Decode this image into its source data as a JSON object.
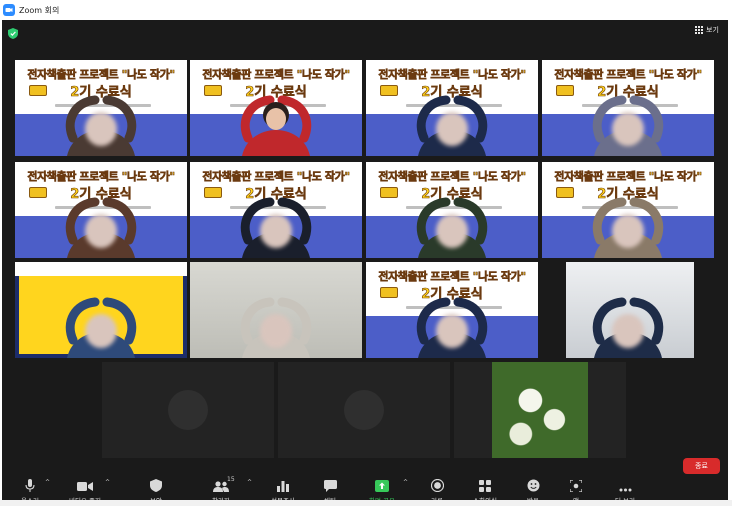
{
  "window": {
    "title": "Zoom 회의"
  },
  "header": {
    "view_label": "보기"
  },
  "slide": {
    "line1": "전자책출판 프로젝트 \"나도 작가\"",
    "line2": "2기 수료식"
  },
  "gallery": {
    "rows": [
      [
        {
          "kind": "slide",
          "active": false
        },
        {
          "kind": "slide",
          "active": true
        },
        {
          "kind": "slide",
          "active": false
        },
        {
          "kind": "slide",
          "active": false
        }
      ],
      [
        {
          "kind": "slide",
          "active": false
        },
        {
          "kind": "slide",
          "active": false
        },
        {
          "kind": "slide",
          "active": false
        },
        {
          "kind": "slide",
          "active": false
        }
      ],
      [
        {
          "kind": "yellow-slide",
          "active": false
        },
        {
          "kind": "room",
          "active": false
        },
        {
          "kind": "slide",
          "active": false
        },
        {
          "kind": "office",
          "active": false
        }
      ],
      [
        {
          "kind": "camera-off",
          "active": false
        },
        {
          "kind": "camera-off",
          "active": false
        },
        {
          "kind": "flowers",
          "active": false
        }
      ]
    ]
  },
  "toolbar": {
    "mute": "음소거",
    "video": "비디오 중지",
    "security": "보안",
    "participants": "참가자",
    "participants_count": "15",
    "polls": "설문조사",
    "chat": "채팅",
    "share": "화면 공유",
    "record": "기록",
    "breakout": "소회의실",
    "reactions": "반응",
    "apps": "앱",
    "more": "더 보기",
    "end": "종료"
  },
  "colors": {
    "stage": "#1a1a1a",
    "active_border": "#9ec93a",
    "share_green": "#37c85a",
    "end_red": "#d82b2b",
    "banner_blue": "#4c5ec8",
    "banner_yellow": "#f2c21a"
  }
}
